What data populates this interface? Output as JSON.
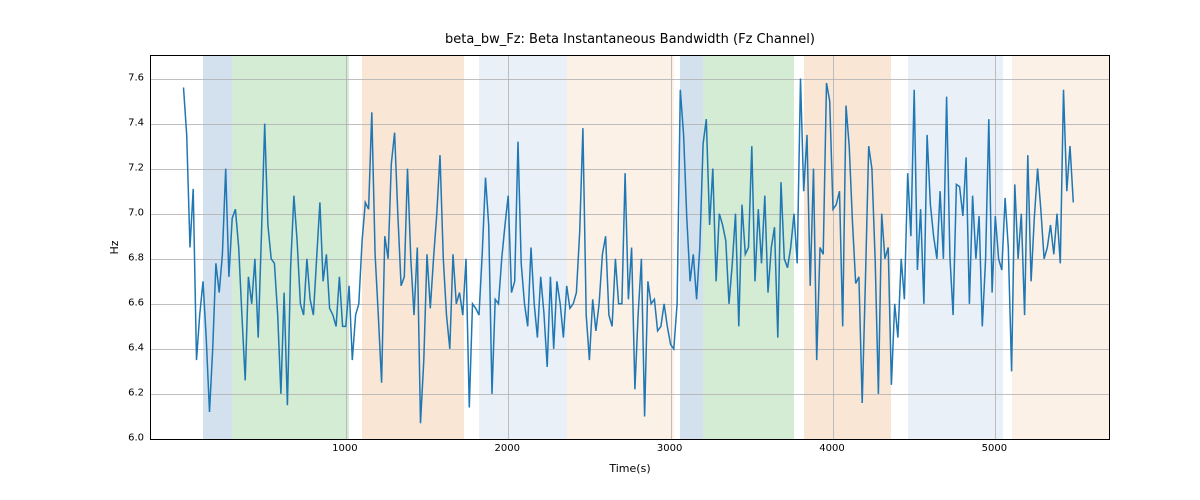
{
  "chart_data": {
    "type": "line",
    "title": "beta_bw_Fz: Beta Instantaneous Bandwidth (Fz Channel)",
    "xlabel": "Time(s)",
    "ylabel": "Hz",
    "xlim": [
      -200,
      5700
    ],
    "ylim": [
      6.0,
      7.7
    ],
    "x_ticks": [
      1000,
      2000,
      3000,
      4000,
      5000
    ],
    "y_ticks": [
      6.0,
      6.2,
      6.4,
      6.6,
      6.8,
      7.0,
      7.2,
      7.4,
      7.6
    ],
    "bands": [
      {
        "x0": 120,
        "x1": 300,
        "color": "#4a87b8"
      },
      {
        "x0": 300,
        "x1": 1020,
        "color": "#53b153"
      },
      {
        "x0": 1100,
        "x1": 1730,
        "color": "#e89a53"
      },
      {
        "x0": 1820,
        "x1": 2360,
        "color": "#a7c3de"
      },
      {
        "x0": 2360,
        "x1": 3020,
        "color": "#f0c9a0"
      },
      {
        "x0": 3060,
        "x1": 3200,
        "color": "#4a87b8"
      },
      {
        "x0": 3200,
        "x1": 3760,
        "color": "#53b153"
      },
      {
        "x0": 3820,
        "x1": 4360,
        "color": "#e89a53"
      },
      {
        "x0": 4460,
        "x1": 5050,
        "color": "#a7c3de"
      },
      {
        "x0": 5100,
        "x1": 5700,
        "color": "#f0c9a0"
      }
    ],
    "series": [
      {
        "name": "beta_bw_Fz",
        "x_start": 0,
        "x_step": 20,
        "y": [
          7.56,
          7.35,
          6.85,
          7.11,
          6.35,
          6.55,
          6.7,
          6.45,
          6.12,
          6.4,
          6.78,
          6.65,
          6.82,
          7.2,
          6.72,
          6.98,
          7.02,
          6.85,
          6.55,
          6.26,
          6.72,
          6.6,
          6.8,
          6.45,
          6.9,
          7.4,
          6.95,
          6.8,
          6.78,
          6.55,
          6.2,
          6.65,
          6.15,
          6.76,
          7.08,
          6.88,
          6.6,
          6.55,
          6.8,
          6.62,
          6.55,
          6.8,
          7.05,
          6.7,
          6.82,
          6.58,
          6.55,
          6.5,
          6.72,
          6.5,
          6.5,
          6.68,
          6.35,
          6.55,
          6.6,
          6.88,
          7.05,
          7.02,
          7.45,
          6.82,
          6.55,
          6.25,
          6.9,
          6.8,
          7.22,
          7.36,
          7.0,
          6.68,
          6.72,
          7.2,
          6.8,
          6.55,
          6.85,
          6.07,
          6.35,
          6.82,
          6.58,
          6.8,
          7.0,
          7.26,
          6.8,
          6.55,
          6.4,
          6.82,
          6.6,
          6.65,
          6.55,
          6.8,
          6.14,
          6.6,
          6.58,
          6.55,
          6.82,
          7.16,
          6.95,
          6.2,
          6.62,
          6.6,
          6.8,
          6.95,
          7.08,
          6.65,
          6.7,
          7.32,
          6.78,
          6.6,
          6.5,
          6.85,
          6.6,
          6.45,
          6.72,
          6.56,
          6.32,
          6.72,
          6.4,
          6.7,
          6.6,
          6.45,
          6.68,
          6.58,
          6.6,
          6.65,
          6.92,
          7.38,
          6.55,
          6.35,
          6.62,
          6.48,
          6.6,
          6.82,
          6.9,
          6.55,
          6.5,
          6.8,
          6.6,
          6.6,
          7.18,
          6.62,
          6.85,
          6.22,
          6.55,
          6.8,
          6.1,
          6.7,
          6.6,
          6.62,
          6.48,
          6.5,
          6.6,
          6.5,
          6.42,
          6.4,
          6.6,
          7.55,
          7.35,
          6.98,
          6.7,
          6.82,
          6.62,
          6.85,
          7.31,
          7.42,
          6.95,
          7.2,
          6.7,
          7.0,
          6.95,
          6.88,
          6.6,
          6.78,
          7.0,
          6.5,
          7.04,
          6.82,
          6.85,
          7.3,
          6.7,
          7.02,
          6.78,
          7.08,
          6.65,
          6.85,
          6.94,
          6.45,
          7.14,
          6.8,
          6.76,
          6.85,
          7.0,
          6.78,
          7.6,
          7.1,
          7.35,
          6.68,
          7.2,
          6.35,
          6.85,
          6.82,
          7.58,
          7.5,
          7.02,
          7.04,
          7.1,
          6.5,
          7.48,
          7.3,
          6.96,
          6.69,
          6.72,
          6.16,
          6.7,
          7.3,
          7.2,
          6.79,
          6.2,
          7.0,
          6.8,
          6.85,
          6.24,
          6.6,
          6.45,
          6.8,
          6.62,
          7.18,
          6.9,
          7.55,
          6.75,
          7.02,
          6.6,
          7.35,
          7.04,
          6.9,
          6.8,
          7.1,
          6.8,
          7.52,
          6.81,
          6.55,
          7.13,
          7.12,
          6.99,
          7.25,
          6.6,
          7.08,
          6.8,
          6.99,
          6.5,
          6.8,
          7.42,
          6.65,
          6.99,
          6.8,
          6.75,
          7.07,
          6.85,
          6.3,
          7.13,
          6.8,
          7.0,
          6.55,
          7.26,
          6.7,
          6.98,
          7.2,
          7.02,
          6.8,
          6.85,
          6.95,
          6.82,
          7.0,
          6.78,
          7.55,
          7.1,
          7.3,
          7.05
        ]
      }
    ]
  }
}
